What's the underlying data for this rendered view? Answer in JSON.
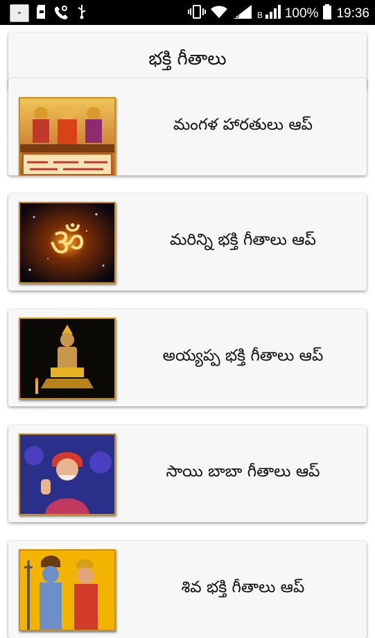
{
  "status_bar": {
    "battery": "100%",
    "time": "19:36",
    "icons": [
      "app-thumbnail-icon",
      "sd-card-icon",
      "phone-settings-icon",
      "usb-icon",
      "vibrate-icon",
      "wifi-icon",
      "signal-icon",
      "signal-2-icon",
      "battery-icon"
    ]
  },
  "header": {
    "title": "భక్తి గీతాలు"
  },
  "items": [
    {
      "label": "మంగళ హారతులు ఆప్",
      "image": "goddesses-mangala-harathulu-image"
    },
    {
      "label": "మరిన్ని భక్తి గీతాలు ఆప్",
      "image": "om-symbol-image"
    },
    {
      "label": "అయ్యప్ప భక్తి గీతాలు ఆప్",
      "image": "ayyappa-image"
    },
    {
      "label": "సాయి బాబా గీతాలు ఆప్",
      "image": "sai-baba-image"
    },
    {
      "label": "శివ భక్తి గీతాలు ఆప్",
      "image": "shiva-parvati-image"
    }
  ],
  "colors": {
    "card": "#f7f7f7",
    "frame": "#c8901a",
    "statusbar": "#000000"
  }
}
